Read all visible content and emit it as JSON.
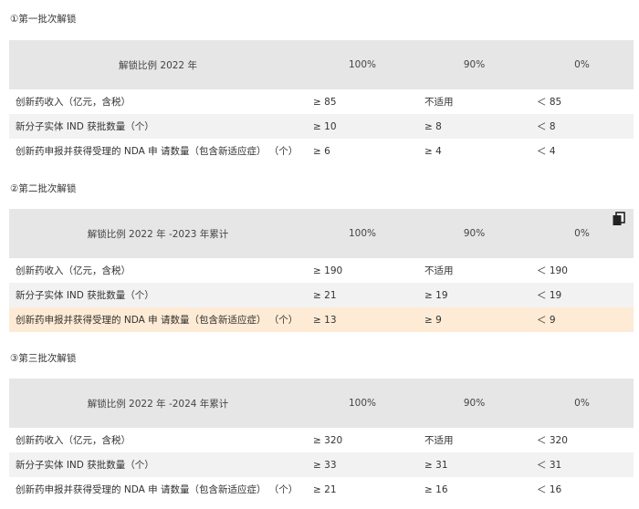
{
  "sections": [
    {
      "title": "①第一批次解锁",
      "header": [
        "解锁比例 2022 年",
        "100%",
        "90%",
        "0%"
      ],
      "rows": [
        [
          "创新药收入（亿元，含税）",
          "≥ 85",
          "不适用",
          "＜ 85"
        ],
        [
          "新分子实体 IND 获批数量（个）",
          "≥ 10",
          "≥ 8",
          "＜ 8"
        ],
        [
          "创新药申报并获得受理的 NDA 申 请数量（包含新适应症） （个）",
          "≥ 6",
          "≥ 4",
          "＜ 4"
        ]
      ]
    },
    {
      "title": "②第二批次解锁",
      "header": [
        "解锁比例 2022 年 -2023 年累计",
        "100%",
        "90%",
        "0%"
      ],
      "rows": [
        [
          "创新药收入（亿元，含税）",
          "≥ 190",
          "不适用",
          "＜ 190"
        ],
        [
          "新分子实体 IND 获批数量（个）",
          "≥ 21",
          "≥ 19",
          "＜ 19"
        ],
        [
          "创新药申报并获得受理的 NDA 申 请数量（包含新适应症） （个）",
          "≥ 13",
          "≥ 9",
          "＜ 9"
        ]
      ]
    },
    {
      "title": "③第三批次解锁",
      "header": [
        "解锁比例 2022 年 -2024 年累计",
        "100%",
        "90%",
        "0%"
      ],
      "rows": [
        [
          "创新药收入（亿元，含税）",
          "≥ 320",
          "不适用",
          "＜ 320"
        ],
        [
          "新分子实体 IND 获批数量（个）",
          "≥ 33",
          "≥ 31",
          "＜ 31"
        ],
        [
          "创新药申报并获得受理的 NDA 申 请数量（包含新适应症） （个）",
          "≥ 21",
          "≥ 16",
          "＜ 16"
        ]
      ]
    }
  ],
  "icons": {
    "copy": "copy-icon"
  },
  "colors": {
    "header_bg": "#e6e6e6",
    "stripe_bg": "#f2f2f2",
    "highlight_bg": "#fdebd5"
  }
}
